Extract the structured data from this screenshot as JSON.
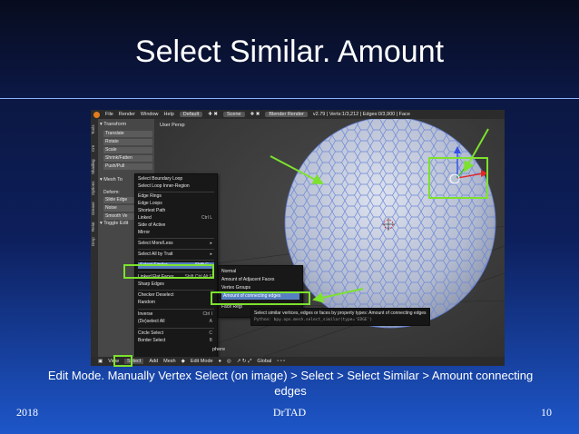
{
  "slide": {
    "title": "Select Similar. Amount",
    "caption": "Edit Mode. Manually Vertex Select (on image) > Select > Select Similar > Amount connecting edges",
    "footer_left": "2018",
    "footer_center": "DrTAD",
    "footer_right": "10"
  },
  "blender": {
    "topbar": {
      "menus": [
        "File",
        "Render",
        "Window",
        "Help"
      ],
      "layout": "Default",
      "scene": "Scene",
      "engine": "Blender Render",
      "stats": "v2.79 | Verts:1/3,212 | Edges:0/3,900 | Face"
    },
    "left_tabs": [
      "Tools",
      "Cre",
      "Shading",
      "Options",
      "Grease",
      "Relat",
      "Drop"
    ],
    "toolshelf": {
      "transform_header": "▾ Transform",
      "transform_tools": [
        "Translate",
        "Rotate",
        "Scale",
        "Shrink/Fatten",
        "Push/Pull"
      ],
      "mesh_tools_header": "▾ Mesh To",
      "deform_label": "Deform:",
      "deform_tools": [
        "Slide Edge",
        "Noise",
        "Smooth Ve"
      ],
      "toggle_header": "▾ Toggle Edit"
    },
    "viewport_label": "User Persp",
    "select_menu": {
      "items": [
        {
          "label": "Select Boundary Loop",
          "shortcut": ""
        },
        {
          "label": "Select Loop Inner-Region",
          "shortcut": ""
        },
        {
          "label": "Edge Rings",
          "shortcut": ""
        },
        {
          "label": "Edge Loops",
          "shortcut": ""
        },
        {
          "label": "Shortest Path",
          "shortcut": ""
        },
        {
          "label": "Linked",
          "shortcut": "Ctrl L"
        },
        {
          "label": "Side of Active",
          "shortcut": ""
        },
        {
          "label": "Mirror",
          "shortcut": ""
        },
        {
          "label": "Select More/Less",
          "shortcut": "▸"
        },
        {
          "label": "Select All by Trait",
          "shortcut": "▸"
        },
        {
          "label": "Select Similar",
          "shortcut": "Shift G ▸"
        },
        {
          "label": "Linked Flat Faces",
          "shortcut": "Shift Ctrl Alt F"
        },
        {
          "label": "Sharp Edges",
          "shortcut": ""
        },
        {
          "label": "Checker Deselect",
          "shortcut": ""
        },
        {
          "label": "Random",
          "shortcut": ""
        },
        {
          "label": "Inverse",
          "shortcut": "Ctrl I"
        },
        {
          "label": "(De)select All",
          "shortcut": "A"
        },
        {
          "label": "Circle Select",
          "shortcut": "C"
        },
        {
          "label": "Border Select",
          "shortcut": "B"
        }
      ]
    },
    "similar_menu": {
      "items": [
        "Normal",
        "Amount of Adjacent Faces",
        "Vertex Groups",
        "Amount of connecting edges",
        "Face Regi"
      ]
    },
    "tooltip": {
      "line1": "Select similar vertices, edges or faces by property types: Amount of connecting edges",
      "line2": "Python: bpy.ops.mesh.select_similar(type='EDGE')"
    },
    "bottombar": {
      "items": [
        "View",
        "Select",
        "Add",
        "Mesh",
        "Edit Mode",
        "Global"
      ],
      "hover_label": "phere"
    }
  },
  "colors": {
    "highlight": "#7ce22d",
    "menu_active": "#5680c2",
    "sphere": "#bfc6d8"
  }
}
